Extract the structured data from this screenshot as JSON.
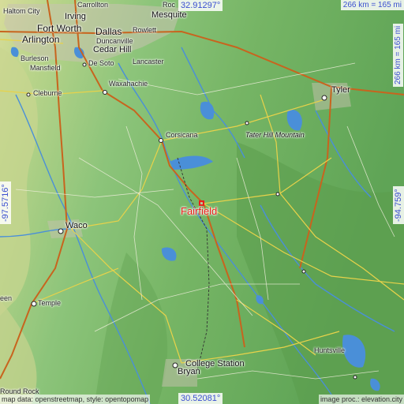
{
  "map": {
    "place_name": "Fairfield",
    "coords": {
      "north": "32.91297°",
      "south": "30.52081°",
      "west": "-97.5716°",
      "east": "-94.759°"
    },
    "scale": "266 km = 165 mi",
    "attribution_left": "map data: openstreetmap, style: opentopomap",
    "attribution_right": "image proc.: elevation.city",
    "cities": [
      {
        "id": "haltom-city",
        "name": "Haltom City",
        "size": "small"
      },
      {
        "id": "irving",
        "name": "Irving",
        "size": "normal"
      },
      {
        "id": "carrollton",
        "name": "Carrollton",
        "size": "small"
      },
      {
        "id": "rockwall",
        "name": "Roc",
        "size": "small"
      },
      {
        "id": "mesquite",
        "name": "Mesquite",
        "size": "normal"
      },
      {
        "id": "fort-worth",
        "name": "Fort Worth",
        "size": "big"
      },
      {
        "id": "dallas",
        "name": "Dallas",
        "size": "big"
      },
      {
        "id": "rowlett",
        "name": "Rowlett",
        "size": "small"
      },
      {
        "id": "arlington",
        "name": "Arlington",
        "size": "big"
      },
      {
        "id": "duncanville",
        "name": "Duncanville",
        "size": "small"
      },
      {
        "id": "cedar-hill",
        "name": "Cedar Hill",
        "size": "normal"
      },
      {
        "id": "burleson",
        "name": "Burleson",
        "size": "small"
      },
      {
        "id": "mansfield",
        "name": "Mansfield",
        "size": "small"
      },
      {
        "id": "de-soto",
        "name": "De Soto",
        "size": "small"
      },
      {
        "id": "lancaster",
        "name": "Lancaster",
        "size": "small"
      },
      {
        "id": "waxahachie",
        "name": "Waxahachie",
        "size": "small"
      },
      {
        "id": "cleburne",
        "name": "Cleburne",
        "size": "small"
      },
      {
        "id": "tyler",
        "name": "Tyler",
        "size": "normal"
      },
      {
        "id": "corsicana",
        "name": "Corsicana",
        "size": "small"
      },
      {
        "id": "tater-hill",
        "name": "Tater Hill Mountain",
        "size": "italic"
      },
      {
        "id": "waco",
        "name": "Waco",
        "size": "normal"
      },
      {
        "id": "temple",
        "name": "Temple",
        "size": "small"
      },
      {
        "id": "killeen",
        "name": "een",
        "size": "small"
      },
      {
        "id": "bryan",
        "name": "Bryan",
        "size": "normal"
      },
      {
        "id": "college-station",
        "name": "College Station",
        "size": "normal"
      },
      {
        "id": "huntsville",
        "name": "Huntsville",
        "size": "small"
      },
      {
        "id": "round-rock",
        "name": "Round Rock",
        "size": "small"
      }
    ]
  },
  "colors": {
    "marker": "#e8201a",
    "coord_text": "#3a4fd0",
    "water": "#4a8fd8"
  }
}
